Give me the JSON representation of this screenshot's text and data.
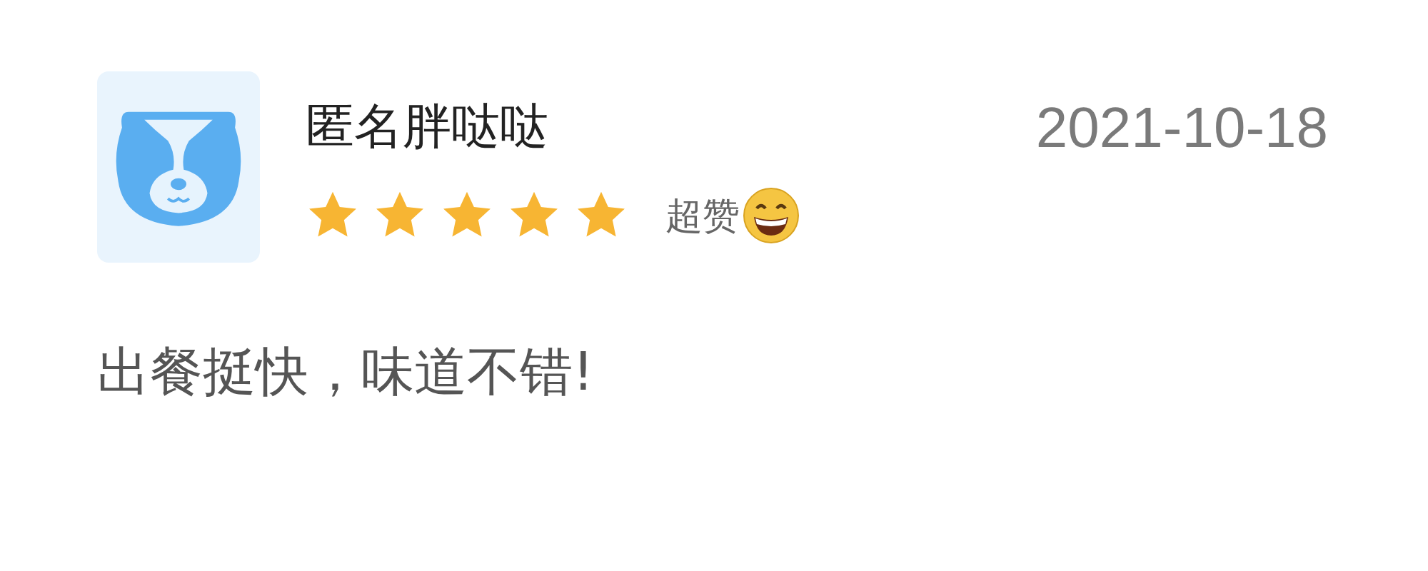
{
  "review": {
    "user_name": "匿名胖哒哒",
    "date": "2021-10-18",
    "stars": 5,
    "rating_label": "超赞",
    "comment": "出餐挺快，味道不错!"
  }
}
